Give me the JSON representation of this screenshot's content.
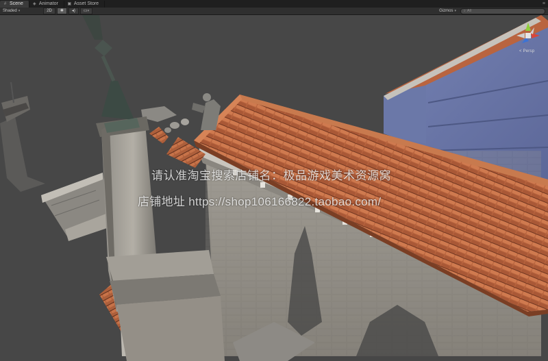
{
  "tabs": [
    {
      "label": "Scene",
      "icon": "scene-grid-icon",
      "active": true
    },
    {
      "label": "Animator",
      "icon": "animator-icon",
      "active": false
    },
    {
      "label": "Asset Store",
      "icon": "asset-store-icon",
      "active": false
    }
  ],
  "toolbar": {
    "shading_mode": "Shaded",
    "mode_2d": "2D",
    "lighting_icon": "sun-icon",
    "audio_icon": "speaker-icon",
    "effects_icon": "image-icon",
    "gizmos_label": "Gizmos",
    "search_placeholder": "All"
  },
  "gizmo": {
    "projection_label": "< Persp",
    "axis_colors": {
      "x": "#d8473a",
      "y": "#8fcf3a",
      "z": "#3b73d6"
    }
  },
  "watermark": {
    "line1": "请认准淘宝搜索店铺名：极品游戏美术资源窝",
    "line2": "店铺地址 https://shop106166822.taobao.com/"
  }
}
